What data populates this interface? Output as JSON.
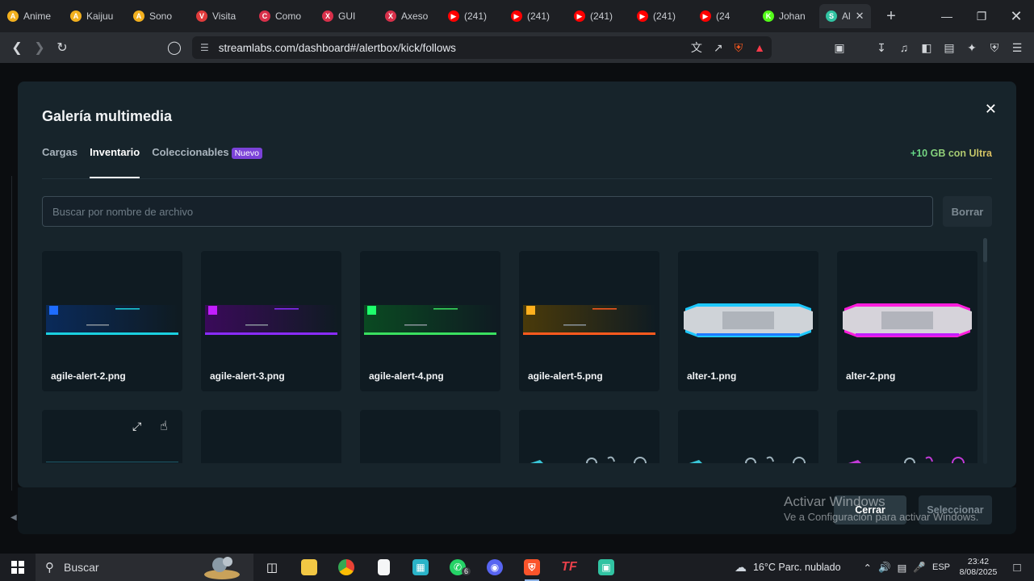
{
  "browser": {
    "tabs": [
      {
        "label": "Anime",
        "color": "#f2b01e",
        "glyph": "A"
      },
      {
        "label": "Kaijuu",
        "color": "#f2b01e",
        "glyph": "A"
      },
      {
        "label": "Sono",
        "color": "#f2b01e",
        "glyph": "A"
      },
      {
        "label": "Visita",
        "color": "#e03b3b",
        "glyph": "V"
      },
      {
        "label": "Como",
        "color": "#d8304a",
        "glyph": "C"
      },
      {
        "label": "GUI",
        "color": "#d8304a",
        "glyph": "X"
      },
      {
        "label": "Axeso",
        "color": "#d8304a",
        "glyph": "X"
      },
      {
        "label": "(241)",
        "color": "#ff0000",
        "glyph": "▶"
      },
      {
        "label": "(241)",
        "color": "#ff0000",
        "glyph": "▶"
      },
      {
        "label": "(241)",
        "color": "#ff0000",
        "glyph": "▶"
      },
      {
        "label": "(241)",
        "color": "#ff0000",
        "glyph": "▶"
      },
      {
        "label": "(24",
        "color": "#ff0000",
        "glyph": "▶"
      },
      {
        "label": "Johan",
        "color": "#53fc18",
        "glyph": "K"
      },
      {
        "label": "Al",
        "color": "#31c3a2",
        "glyph": "S"
      }
    ],
    "url": "streamlabs.com/dashboard#/alertbox/kick/follows"
  },
  "modal": {
    "title": "Galería multimedia",
    "tabs": [
      {
        "label": "Cargas",
        "active": false
      },
      {
        "label": "Inventario",
        "active": true
      },
      {
        "label": "Coleccionables",
        "active": false
      }
    ],
    "new_badge": "Nuevo",
    "ultra": "+10 GB con Ultra",
    "search_placeholder": "Buscar por nombre de archivo",
    "clear_button": "Borrar",
    "items": [
      {
        "name": "agile-alert-2.png",
        "accent": "#1e6cff",
        "bar": "#1ad0e0",
        "bg": "#0a2a5a"
      },
      {
        "name": "agile-alert-3.png",
        "accent": "#c21eff",
        "bar": "#8a2cff",
        "bg": "#3a0a5a"
      },
      {
        "name": "agile-alert-4.png",
        "accent": "#1eff6c",
        "bar": "#3ae060",
        "bg": "#0a4a22"
      },
      {
        "name": "agile-alert-5.png",
        "accent": "#ffb01e",
        "bar": "#ff5a1e",
        "bg": "#4a3a0a"
      },
      {
        "name": "alter-1.png",
        "accent": "#1ec8ff",
        "bar": "#1e7aff",
        "bg": "#cfd3d8"
      },
      {
        "name": "alter-2.png",
        "accent": "#ff1edc",
        "bar": "#c21eff",
        "bg": "#d6d3da"
      }
    ],
    "cancel_button": "Cerrar",
    "select_button": "Seleccionar"
  },
  "windows_watermark": {
    "title": "Activar Windows",
    "subtitle": "Ve a Configuración para activar Windows."
  },
  "taskbar": {
    "search_label": "Buscar",
    "whatsapp_badge": "6",
    "weather": "16°C  Parc. nublado",
    "language": "ESP",
    "time": "23:42",
    "date": "8/08/2025"
  }
}
